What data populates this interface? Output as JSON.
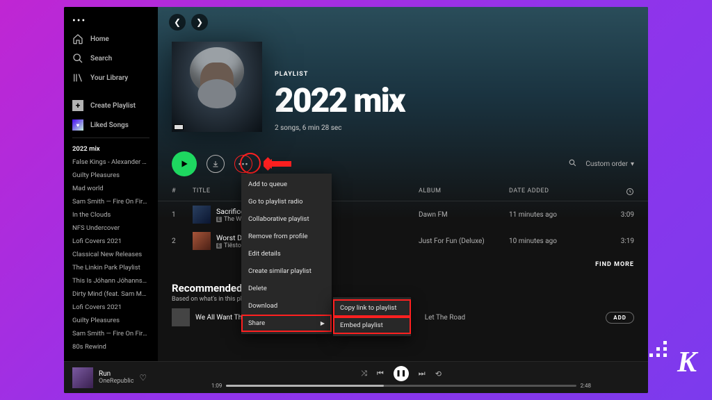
{
  "sidebar": {
    "nav": {
      "home": "Home",
      "search": "Search",
      "library": "Your Library",
      "create": "Create Playlist",
      "liked": "Liked Songs"
    },
    "playlists": [
      "2022 mix",
      "False Kings - Alexander The...",
      "Guilty Pleasures",
      "Mad world",
      "Sam Smith — Fire On Fire (Fr...",
      "In the Clouds",
      "NFS Undercover",
      "Lofi Covers 2021",
      "Classical New Releases",
      "The Linkin Park Playlist",
      "This Is Jóhann Jóhannsson",
      "Dirty Mind (feat. Sam Martin...",
      "Lofi Covers 2021",
      "Guilty Pleasures",
      "Sam Smith — Fire On Fire (Fr...",
      "80s Rewind"
    ]
  },
  "playlist": {
    "type_label": "PLAYLIST",
    "title": "2022 mix",
    "meta": "2 songs, 6 min 28 sec"
  },
  "sort_label": "Custom order",
  "table": {
    "cols": {
      "num": "#",
      "title": "TITLE",
      "album": "ALBUM",
      "added": "DATE ADDED"
    },
    "rows": [
      {
        "num": "1",
        "title": "Sacrifice",
        "artist": "The Weeknd",
        "album": "Dawn FM",
        "added": "11 minutes ago",
        "duration": "3:09"
      },
      {
        "num": "2",
        "title": "Worst Day",
        "artist": "Tiësto",
        "album": "Just For Fun (Deluxe)",
        "added": "10 minutes ago",
        "duration": "3:19"
      }
    ]
  },
  "find_more": "FIND MORE",
  "recommended": {
    "title": "Recommended",
    "subtitle": "Based on what's in this playlist",
    "row": {
      "title": "We All Want The Same Thing",
      "album": "Let The Road",
      "add": "ADD"
    }
  },
  "context_menu": {
    "items": [
      "Add to queue",
      "Go to playlist radio",
      "Collaborative playlist",
      "Remove from profile",
      "Edit details",
      "Create similar playlist",
      "Delete",
      "Download"
    ],
    "share": "Share",
    "sub": {
      "copy": "Copy link to playlist",
      "embed": "Embed playlist"
    }
  },
  "now_playing": {
    "title": "Run",
    "artist": "OneRepublic",
    "elapsed": "1:09",
    "total": "2:48"
  }
}
